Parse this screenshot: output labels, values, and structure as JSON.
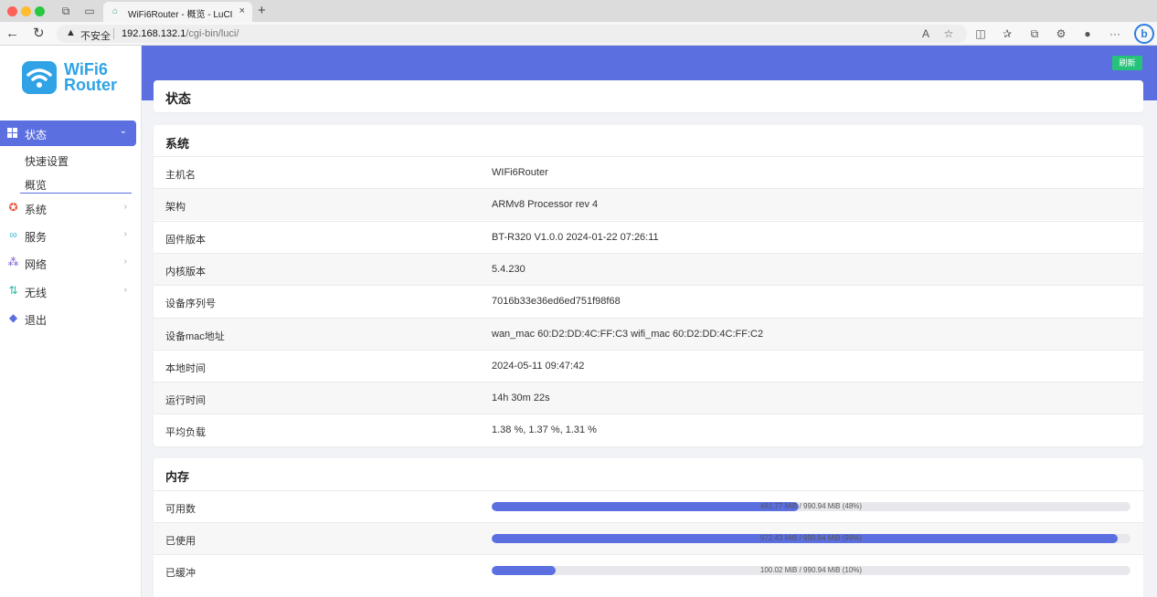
{
  "browser": {
    "tab_title": "WiFi6Router - 概览 - LuCI",
    "tab_close": "×",
    "new_tab": "+",
    "insecure_label": "不安全",
    "url_host": "192.168.132.1",
    "url_path": "/cgi-bin/luci/",
    "more": "···",
    "bing": "b"
  },
  "brand": {
    "line1": "WiFi6",
    "line2": "Router",
    "color": "#2fa3e6"
  },
  "sidebar": {
    "active": {
      "label": "状态",
      "caret": "⌄"
    },
    "sub_items": [
      "快速设置",
      "概览"
    ],
    "items": [
      {
        "label": "系统",
        "icon": "gear-icon",
        "glyph": "✪",
        "color": "#e8553e",
        "chevron": "›"
      },
      {
        "label": "服务",
        "icon": "link-icon",
        "glyph": "∞",
        "color": "#3bb6d6",
        "chevron": "›"
      },
      {
        "label": "网络",
        "icon": "network-icon",
        "glyph": "⁂",
        "color": "#7c5cd6",
        "chevron": "›"
      },
      {
        "label": "无线",
        "icon": "wireless-icon",
        "glyph": "⇅",
        "color": "#2fb8a6",
        "chevron": "›"
      },
      {
        "label": "退出",
        "icon": "logout-icon",
        "glyph": "◆",
        "color": "#5b6fe0",
        "chevron": ""
      }
    ]
  },
  "header": {
    "refresh": "刷新"
  },
  "page": {
    "title": "状态"
  },
  "system": {
    "title": "系统",
    "rows": [
      {
        "label": "主机名",
        "value": "WIFi6Router"
      },
      {
        "label": "架构",
        "value": "ARMv8 Processor rev 4"
      },
      {
        "label": "固件版本",
        "value": "BT-R320 V1.0.0 2024-01-22 07:26:11"
      },
      {
        "label": "内核版本",
        "value": "5.4.230"
      },
      {
        "label": "设备序列号",
        "value": "7016b33e36ed6ed751f98f68"
      },
      {
        "label": "设备mac地址",
        "value": "wan_mac 60:D2:DD:4C:FF:C3 wifi_mac 60:D2:DD:4C:FF:C2"
      },
      {
        "label": "本地时间",
        "value": "2024-05-11 09:47:42"
      },
      {
        "label": "运行时间",
        "value": "14h 30m 22s"
      },
      {
        "label": "平均负载",
        "value": "1.38 %, 1.37 %, 1.31 %"
      }
    ]
  },
  "memory": {
    "title": "内存",
    "rows": [
      {
        "label": "可用数",
        "text": "481.77 MiB / 990.94 MiB (48%)",
        "percent": 48
      },
      {
        "label": "已使用",
        "text": "972.43 MiB / 990.94 MiB (98%)",
        "percent": 98
      },
      {
        "label": "已缓冲",
        "text": "100.02 MiB / 990.94 MiB (10%)",
        "percent": 10
      }
    ]
  },
  "colors": {
    "accent": "#5b6fe0",
    "success": "#27c27a"
  }
}
